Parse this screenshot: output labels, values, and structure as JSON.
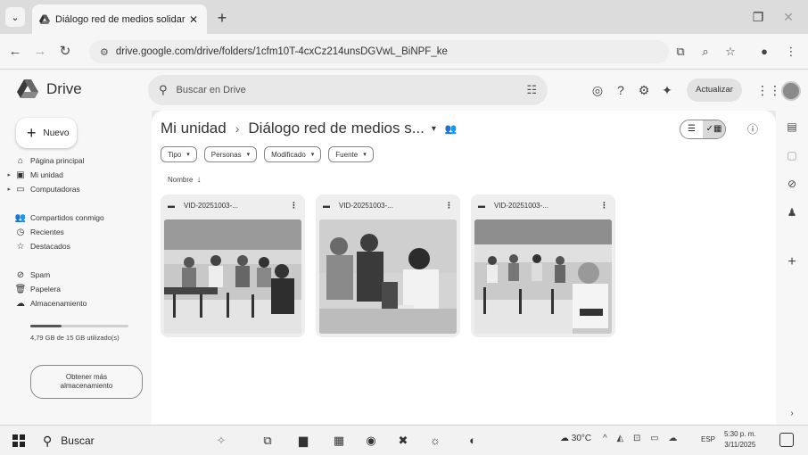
{
  "browser": {
    "tab_title": "Diálogo red de medios solidar",
    "url": "drive.google.com/drive/folders/1cfm10T-4cxCz214unsDGVwL_BiNPF_ke"
  },
  "drive": {
    "app_name": "Drive",
    "search_placeholder": "Buscar en Drive",
    "upgrade_label": "Actualizar"
  },
  "sidebar": {
    "new_label": "Nuevo",
    "items": [
      {
        "label": "Página principal",
        "icon": "home-icon"
      },
      {
        "label": "Mi unidad",
        "icon": "my-drive-icon"
      },
      {
        "label": "Computadoras",
        "icon": "computer-icon"
      },
      {
        "label": "Compartidos conmigo",
        "icon": "shared-icon"
      },
      {
        "label": "Recientes",
        "icon": "clock-icon"
      },
      {
        "label": "Destacados",
        "icon": "star-icon"
      },
      {
        "label": "Spam",
        "icon": "spam-icon"
      },
      {
        "label": "Papelera",
        "icon": "trash-icon"
      },
      {
        "label": "Almacenamiento",
        "icon": "cloud-icon"
      }
    ],
    "storage_text": "4,79 GB de 15 GB utilizado(s)",
    "storage_fraction": 0.32,
    "more_storage_label": "Obtener más almacenamiento"
  },
  "main": {
    "breadcrumb_root": "Mi unidad",
    "breadcrumb_folder": "Diálogo red de medios s...",
    "filters": [
      "Tipo",
      "Personas",
      "Modificado",
      "Fuente"
    ],
    "sort_label": "Nombre",
    "files": [
      {
        "name": "VID-20251003-..."
      },
      {
        "name": "VID-20251003-..."
      },
      {
        "name": "VID-20251003-..."
      }
    ]
  },
  "taskbar": {
    "search_label": "Buscar",
    "weather": "30°C",
    "language": "ESP",
    "time": "5:30 p. m.",
    "date": "3/11/2025"
  }
}
